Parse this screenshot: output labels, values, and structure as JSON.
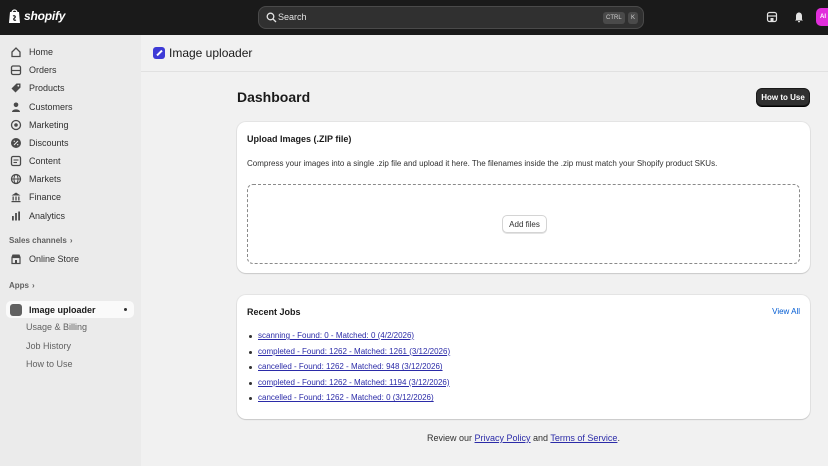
{
  "topbar": {
    "brand": "shopify",
    "search_label": "Search",
    "shortcut_ctrl": "CTRL",
    "shortcut_k": "K",
    "avatar_initials": "AI"
  },
  "sidebar": {
    "items": [
      {
        "label": "Home",
        "icon": "home-icon"
      },
      {
        "label": "Orders",
        "icon": "orders-icon"
      },
      {
        "label": "Products",
        "icon": "tag-icon"
      },
      {
        "label": "Customers",
        "icon": "person-icon"
      },
      {
        "label": "Marketing",
        "icon": "target-icon"
      },
      {
        "label": "Discounts",
        "icon": "discount-icon"
      },
      {
        "label": "Content",
        "icon": "content-icon"
      },
      {
        "label": "Markets",
        "icon": "globe-icon"
      },
      {
        "label": "Finance",
        "icon": "bank-icon"
      },
      {
        "label": "Analytics",
        "icon": "chart-icon"
      }
    ],
    "sales_channels_title": "Sales channels",
    "online_store": "Online Store",
    "apps_title": "Apps",
    "app_name": "Image uploader",
    "app_subitems": [
      "Usage & Billing",
      "Job History",
      "How to Use"
    ]
  },
  "app_header": {
    "title": "Image uploader"
  },
  "page": {
    "title": "Dashboard",
    "how_to_use_button": "How to Use"
  },
  "upload_card": {
    "title": "Upload Images (.ZIP file)",
    "description": "Compress your images into a single .zip file and upload it here. The filenames inside the .zip must match your Shopify product SKUs.",
    "add_files_button": "Add files"
  },
  "jobs_card": {
    "title": "Recent Jobs",
    "view_all": "View All",
    "jobs": [
      "scanning - Found: 0 - Matched: 0 (4/2/2026)",
      "completed - Found: 1262 - Matched: 1261 (3/12/2026)",
      "cancelled - Found: 1262 - Matched: 948 (3/12/2026)",
      "completed - Found: 1262 - Matched: 1194 (3/12/2026)",
      "cancelled - Found: 1262 - Matched: 0 (3/12/2026)"
    ]
  },
  "footer": {
    "prefix": "Review our ",
    "privacy_link": "Privacy Policy",
    "middle": " and ",
    "terms_link": "Terms of Service",
    "suffix": "."
  }
}
